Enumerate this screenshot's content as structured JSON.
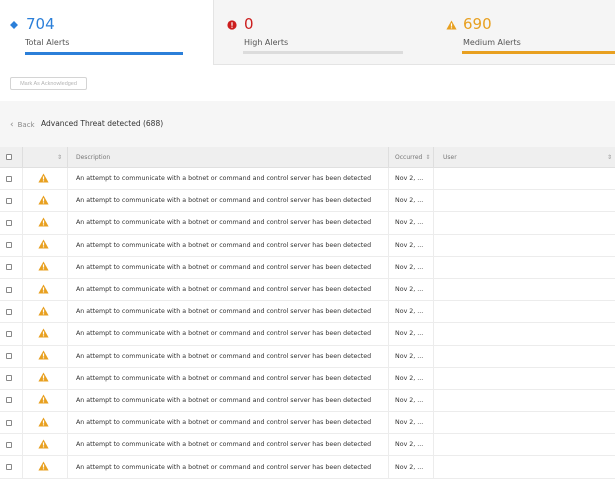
{
  "summary": {
    "total": {
      "count": "704",
      "label": "Total Alerts",
      "color": "#2b7fd9",
      "icon": "diamond-icon"
    },
    "high": {
      "count": "0",
      "label": "High Alerts",
      "color": "#cc1d1d",
      "icon": "exclamation-circle-icon"
    },
    "medium": {
      "count": "690",
      "label": "Medium Alerts",
      "color": "#e8a020",
      "icon": "warning-triangle-icon"
    }
  },
  "toolbar": {
    "ack_label": "Mark As Acknowledged"
  },
  "panel": {
    "back_label": "Back",
    "title": "Advanced Threat detected (688)"
  },
  "table": {
    "columns": {
      "description": "Description",
      "occurred": "Occurred",
      "user": "User"
    },
    "rows": [
      {
        "description": "An attempt to communicate with a botnet or command and control server has been detected",
        "occurred": "Nov 2, ...",
        "user": ""
      },
      {
        "description": "An attempt to communicate with a botnet or command and control server has been detected",
        "occurred": "Nov 2, ...",
        "user": ""
      },
      {
        "description": "An attempt to communicate with a botnet or command and control server has been detected",
        "occurred": "Nov 2, ...",
        "user": ""
      },
      {
        "description": "An attempt to communicate with a botnet or command and control server has been detected",
        "occurred": "Nov 2, ...",
        "user": ""
      },
      {
        "description": "An attempt to communicate with a botnet or command and control server has been detected",
        "occurred": "Nov 2, ...",
        "user": ""
      },
      {
        "description": "An attempt to communicate with a botnet or command and control server has been detected",
        "occurred": "Nov 2, ...",
        "user": ""
      },
      {
        "description": "An attempt to communicate with a botnet or command and control server has been detected",
        "occurred": "Nov 2, ...",
        "user": ""
      },
      {
        "description": "An attempt to communicate with a botnet or command and control server has been detected",
        "occurred": "Nov 2, ...",
        "user": ""
      },
      {
        "description": "An attempt to communicate with a botnet or command and control server has been detected",
        "occurred": "Nov 2, ...",
        "user": ""
      },
      {
        "description": "An attempt to communicate with a botnet or command and control server has been detected",
        "occurred": "Nov 2, ...",
        "user": ""
      },
      {
        "description": "An attempt to communicate with a botnet or command and control server has been detected",
        "occurred": "Nov 2, ...",
        "user": ""
      },
      {
        "description": "An attempt to communicate with a botnet or command and control server has been detected",
        "occurred": "Nov 2, ...",
        "user": ""
      },
      {
        "description": "An attempt to communicate with a botnet or command and control server has been detected",
        "occurred": "Nov 2, ...",
        "user": ""
      },
      {
        "description": "An attempt to communicate with a botnet or command and control server has been detected",
        "occurred": "Nov 2, ...",
        "user": ""
      }
    ]
  }
}
